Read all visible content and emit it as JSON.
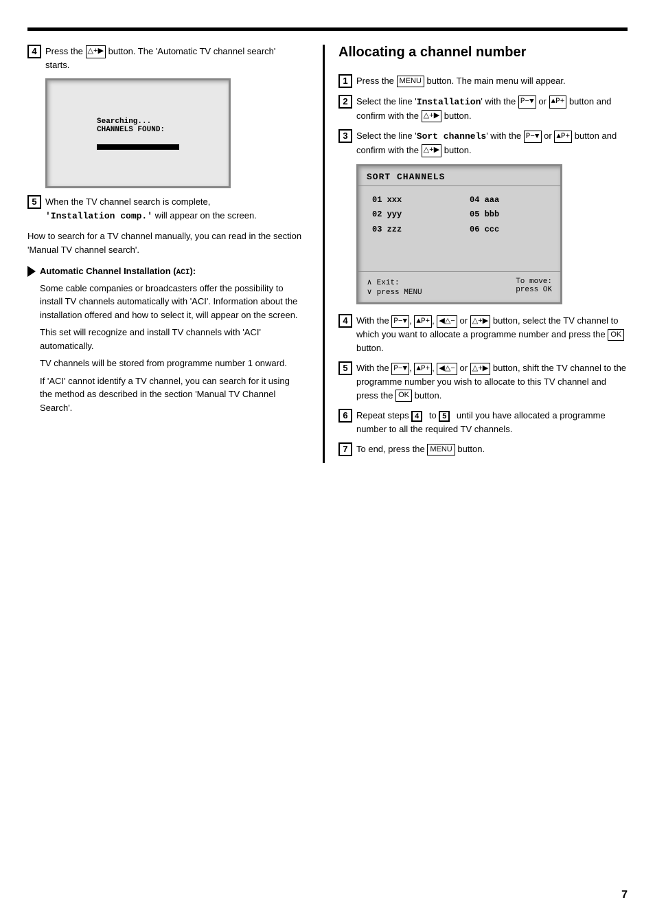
{
  "page": {
    "number": "7"
  },
  "left_column": {
    "step4": {
      "number": "4",
      "text_before": "Press the ",
      "button": "△+▶",
      "text_after": " button. The 'Automatic TV channel search' starts."
    },
    "tv_screen": {
      "line1": "Searching...",
      "line2": "CHANNELS FOUND:"
    },
    "step5": {
      "number": "5",
      "text_before": "When the TV channel search is complete,",
      "code_text": "'Installation comp.'",
      "text_after": " will appear on the screen."
    },
    "manual_note": "How to search for a TV channel manually, you can read in the section 'Manual TV channel search'.",
    "aci_note": {
      "title": "Automatic Channel Installation (ACI):",
      "para1": "Some cable companies or broadcasters offer the possibility to install TV channels automatically with 'ACI'. Information about the installation offered and how to select it, will appear on the screen.",
      "para2": "This set will recognize and install TV channels with 'ACI' automatically.",
      "para3": "TV channels will be stored from programme number 1 onward.",
      "para4": "If 'ACI' cannot identify a TV channel, you can search for it using the method as described in the section 'Manual TV Channel Search'."
    }
  },
  "right_column": {
    "heading": "Allocating a channel number",
    "step1": {
      "number": "1",
      "text_before": "Press the ",
      "button": "MENU",
      "text_after": " button. The main menu will appear."
    },
    "step2": {
      "number": "2",
      "text_before": "Select the line '",
      "code_text": "Installation",
      "text_mid": "' with the ",
      "button1": "P−▼",
      "text_mid2": " or ",
      "button2": "▲P+",
      "text_after": " button and confirm with the ",
      "button3": "△+▶",
      "text_end": " button."
    },
    "step3": {
      "number": "3",
      "text_before": "Select the line '",
      "code_text": "Sort channels",
      "text_mid": "' with the ",
      "button1": "P−▼",
      "text_mid2": " or ",
      "button2": "▲P+",
      "text_after": " button and confirm with the ",
      "button3": "△+▶",
      "text_end": " button."
    },
    "sort_screen": {
      "title": "SORT CHANNELS",
      "col1": [
        "01 xxx",
        "02 yyy",
        "03 zzz"
      ],
      "col2": [
        "04 aaa",
        "05 bbb",
        "06 ccc"
      ],
      "footer_left": "∧ Exit:\n∨ press MENU",
      "footer_right": "To move:\npress OK"
    },
    "step4": {
      "number": "4",
      "text1": "With the ",
      "b1": "P−▼",
      "t2": ", ",
      "b2": "▲P+",
      "t3": ", ",
      "b3": "◀△−",
      "t4": " or ",
      "b4": "△+▶",
      "text_after": " button, select the TV channel to which you want to allocate a programme number and press the ",
      "button_ok": "OK",
      "text_end": " button."
    },
    "step5": {
      "number": "5",
      "text1": "With the ",
      "b1": "P−▼",
      "t2": ", ",
      "b2": "▲P+",
      "t3": ", ",
      "b3": "◀△−",
      "t4": " or ",
      "b4": "△+▶",
      "text_after": " button, shift the TV channel to the programme number you wish to allocate to this TV channel and press the ",
      "button_ok": "OK",
      "text_end": " button."
    },
    "step6": {
      "number": "6",
      "text1": "Repeat steps ",
      "ref4": "4",
      "text2": " to ",
      "ref5": "5",
      "text3": " until you have allocated a programme number to all the required TV channels."
    },
    "step7": {
      "number": "7",
      "text1": "To end, press the ",
      "button": "MENU",
      "text2": " button."
    }
  }
}
